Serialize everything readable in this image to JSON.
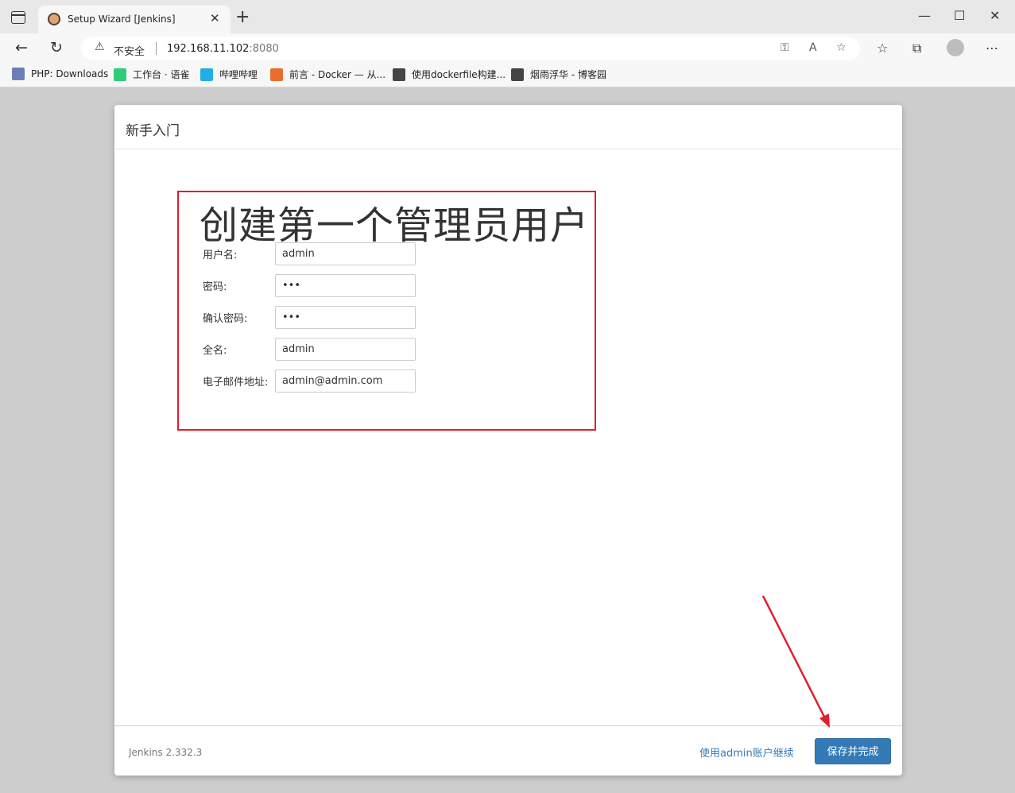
{
  "browser": {
    "tab_title": "Setup Wizard [Jenkins]",
    "tab_close": "✕",
    "new_tab": "+",
    "win_min": "—",
    "win_max": "☐",
    "win_close": "✕",
    "not_secure": "不安全",
    "url_host": "192.168.11.102",
    "url_port": ":8080",
    "favorites": [
      {
        "label": "PHP: Downloads",
        "icon": "php-icon",
        "color": "#6c7eb7"
      },
      {
        "label": "工作台 · 语雀",
        "icon": "yuque-icon",
        "color": "#31cc79"
      },
      {
        "label": "哔哩哔哩",
        "icon": "bilibili-icon",
        "color": "#23ade5"
      },
      {
        "label": "前言 - Docker — 从...",
        "icon": "rocket-icon",
        "color": "#e86f2b"
      },
      {
        "label": "使用dockerfile构建...",
        "icon": "cnblogs-icon",
        "color": "#444444"
      },
      {
        "label": "烟雨浮华 - 博客园",
        "icon": "cnblogs-icon",
        "color": "#444444"
      }
    ]
  },
  "dialog": {
    "title": "新手入门",
    "heading": "创建第一个管理员用户",
    "fields": [
      {
        "label": "用户名:",
        "value": "admin"
      },
      {
        "label": "密码:",
        "value": "•••"
      },
      {
        "label": "确认密码:",
        "value": "•••"
      },
      {
        "label": "全名:",
        "value": "admin"
      },
      {
        "label": "电子邮件地址:",
        "value": "admin@admin.com"
      }
    ],
    "version": "Jenkins 2.332.3",
    "continue_link": "使用admin账户继续",
    "save_button": "保存并完成"
  },
  "colors": {
    "annotation": "#e0202c",
    "primary": "#337ab7"
  }
}
